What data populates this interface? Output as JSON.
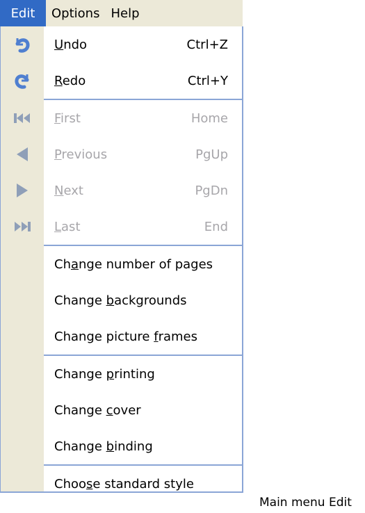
{
  "menubar": {
    "edit": "Edit",
    "options": "Options",
    "help": "Help"
  },
  "menu": {
    "undo": {
      "label": "Undo",
      "mnemonic": "U",
      "shortcut": "Ctrl+Z",
      "icon": "undo-icon"
    },
    "redo": {
      "label": "Redo",
      "mnemonic": "R",
      "shortcut": "Ctrl+Y",
      "icon": "redo-icon"
    },
    "first": {
      "label": "First",
      "mnemonic": "F",
      "shortcut": "Home",
      "icon": "first-page-icon",
      "disabled": true
    },
    "previous": {
      "label": "Previous",
      "mnemonic": "P",
      "shortcut": "PgUp",
      "icon": "previous-page-icon",
      "disabled": true
    },
    "next": {
      "label": "Next",
      "mnemonic": "N",
      "shortcut": "PgDn",
      "icon": "next-page-icon",
      "disabled": true
    },
    "last": {
      "label": "Last",
      "mnemonic": "L",
      "shortcut": "End",
      "icon": "last-page-icon",
      "disabled": true
    },
    "change_pages": {
      "label": "Change number of pages",
      "mnemonic": "a"
    },
    "change_backgrounds": {
      "label": "Change backgrounds",
      "mnemonic": "b"
    },
    "change_frames": {
      "label": "Change picture frames",
      "mnemonic": "f"
    },
    "change_printing": {
      "label": "Change printing",
      "mnemonic": "p"
    },
    "change_cover": {
      "label": "Change cover",
      "mnemonic": "c"
    },
    "change_binding": {
      "label": "Change binding",
      "mnemonic": "b"
    },
    "standard_style": {
      "label": "Choose standard style",
      "mnemonic": "s"
    }
  },
  "caption": "Main menu Edit",
  "colors": {
    "menu_highlight": "#316ac5",
    "icon_strip": "#ece9d8",
    "separator": "#8aa5d6",
    "disabled_text": "#a7a6aa",
    "icon_active": "#4f7fd0",
    "icon_disabled": "#8f9fb8"
  }
}
